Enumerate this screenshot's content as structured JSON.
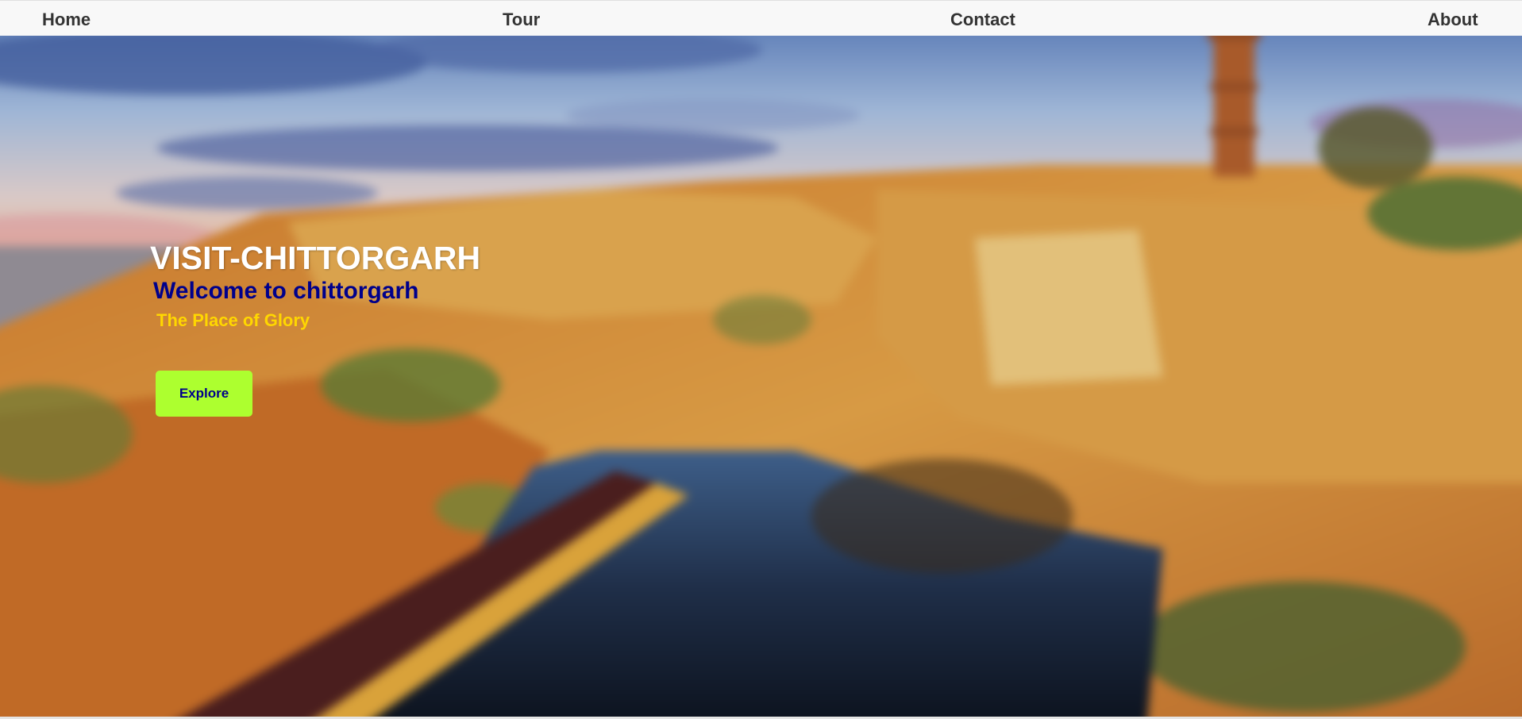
{
  "nav": {
    "items": [
      {
        "label": "Home"
      },
      {
        "label": "Tour"
      },
      {
        "label": "Contact"
      },
      {
        "label": "About"
      }
    ]
  },
  "hero": {
    "title": "VISIT-CHITTORGARH",
    "welcome": "Welcome to chittorgarh",
    "tagline": "The Place of Glory",
    "explore_label": "Explore",
    "background_image": "chittorgarh-fort-landscape"
  },
  "colors": {
    "nav_background": "#f8f8f8",
    "nav_text": "#333333",
    "title_text": "#ffffff",
    "welcome_text": "#00008b",
    "tagline_text": "#ffd700",
    "button_background": "#adff2f",
    "button_text": "#00008b"
  }
}
